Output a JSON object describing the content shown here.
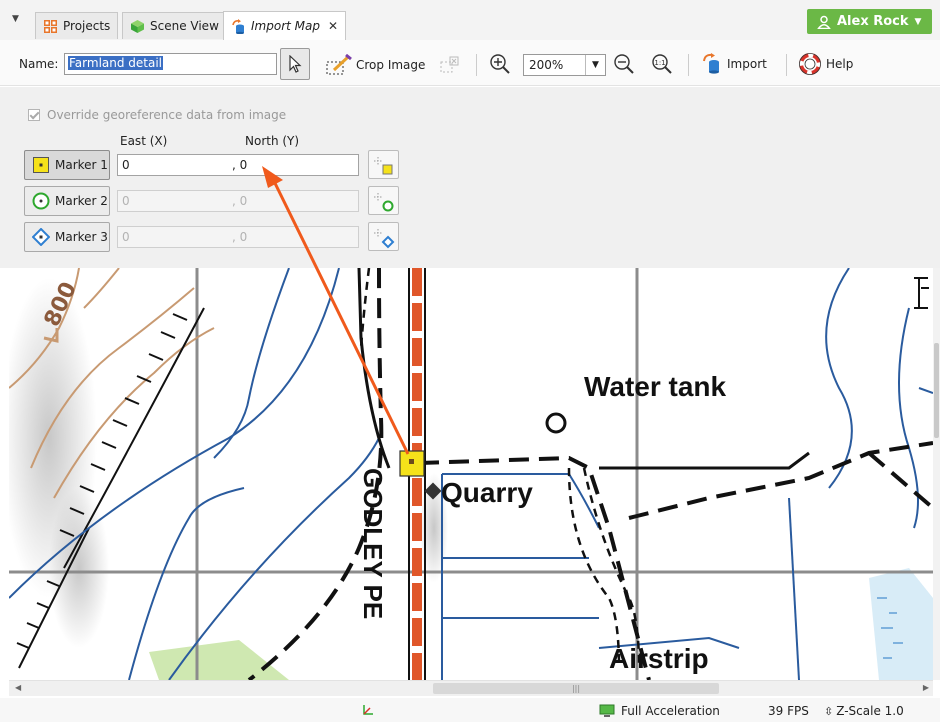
{
  "tabs": [
    {
      "label": "Projects",
      "icon": "projects-icon"
    },
    {
      "label": "Scene View",
      "icon": "scene-view-icon"
    },
    {
      "label": "Import Map",
      "icon": "import-map-icon",
      "active": true
    }
  ],
  "user": {
    "name": "Alex Rock"
  },
  "toolbar": {
    "name_label": "Name:",
    "name_value": "Farmland detail",
    "crop_label": "Crop Image",
    "zoom_value": "200%",
    "import_label": "Import",
    "help_label": "Help"
  },
  "georef": {
    "override_label": "Override georeference data from image",
    "override_checked": true,
    "east_header": "East (X)",
    "north_header": "North (Y)",
    "markers": [
      {
        "label": "Marker 1",
        "east": "0",
        "north": ", 0",
        "enabled": true
      },
      {
        "label": "Marker 2",
        "east": "0",
        "north": ", 0",
        "enabled": false
      },
      {
        "label": "Marker 3",
        "east": "0",
        "north": ", 0",
        "enabled": false
      }
    ]
  },
  "map": {
    "contour_label": "800",
    "labels": {
      "water_tank": "Water tank",
      "quarry": "Quarry",
      "airstrip": "Airstrip",
      "road": "GODLEY PE"
    },
    "colors": {
      "marker": "#f5e21a",
      "arrow": "#f05a1c",
      "rail": "#e0572a",
      "contour": "#c89a72"
    }
  },
  "status": {
    "acceleration": "Full Acceleration",
    "fps": "39 FPS",
    "zscale": "Z-Scale 1.0"
  }
}
